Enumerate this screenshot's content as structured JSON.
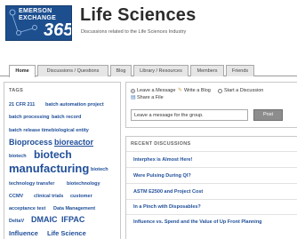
{
  "header": {
    "logo_line1": "EMERSON",
    "logo_line2": "EXCHANGE",
    "logo_number": "365",
    "title": "Life Sciences",
    "subtitle": "Discussions related to the Life Sciences Industry"
  },
  "tabs": [
    {
      "label": "Home",
      "active": true
    },
    {
      "label": "Discussions / Questions",
      "active": false
    },
    {
      "label": "Blog",
      "active": false
    },
    {
      "label": "Library / Resources",
      "active": false
    },
    {
      "label": "Members",
      "active": false
    },
    {
      "label": "Friends",
      "active": false
    }
  ],
  "tags": {
    "title": "TAGS",
    "items": [
      {
        "label": "21 CFR 211"
      },
      {
        "label": "batch automation project"
      },
      {
        "label": "batch processing"
      },
      {
        "label": "batch record"
      },
      {
        "label": "batch release time"
      },
      {
        "label": "biological entity"
      },
      {
        "label": "Bioprocess"
      },
      {
        "label": "bioreactor"
      },
      {
        "label": "biotech"
      },
      {
        "label": "biotech"
      },
      {
        "label": "manufacturing"
      },
      {
        "label": "biotech"
      },
      {
        "label": "technology transfer"
      },
      {
        "label": "biotechnology"
      },
      {
        "label": "CCMV"
      },
      {
        "label": "clinical trials"
      },
      {
        "label": "customer"
      },
      {
        "label": "acceptance test"
      },
      {
        "label": "Data Management"
      },
      {
        "label": "DeltaV"
      },
      {
        "label": "DMAIC"
      },
      {
        "label": "IFPAC"
      },
      {
        "label": "Influence"
      },
      {
        "label": "Life Science"
      }
    ]
  },
  "post": {
    "options": [
      {
        "label": "Leave a Message",
        "checked": true
      },
      {
        "label": "Write a Blog",
        "checked": false
      },
      {
        "label": "Start a Discussion",
        "checked": false
      },
      {
        "label": "Share a File",
        "checked": false
      }
    ],
    "input_value": "Leave a message for the group.",
    "button_label": "Post"
  },
  "discussions": {
    "title": "RECENT DISCUSSIONS",
    "items": [
      {
        "label": "Interphex is Almost Here!"
      },
      {
        "label": "Were Pulsing During QI?"
      },
      {
        "label": "ASTM E2500 and Project Cost"
      },
      {
        "label": "In a Pinch with Disposables?"
      },
      {
        "label": "Influence vs. Spend and the Value of Up Front Planning"
      }
    ]
  },
  "colors": {
    "link": "#1f4e99",
    "logo_bg": "#1d4f8f",
    "tab_bg": "#e6e6e6",
    "post_button": "#8d8d8d"
  }
}
